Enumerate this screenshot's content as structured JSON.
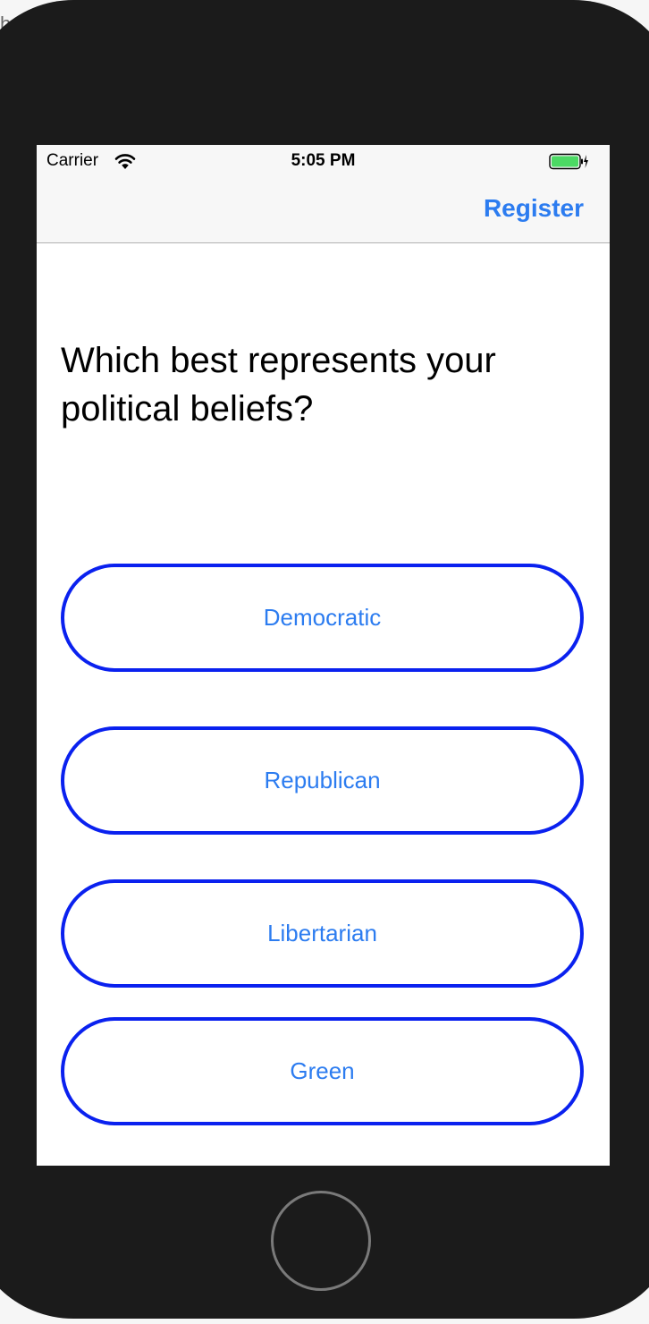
{
  "background": {
    "partial_text": "ho"
  },
  "status_bar": {
    "carrier": "Carrier",
    "time": "5:05 PM",
    "icons": [
      "wifi-icon",
      "battery-icon",
      "charging-bolt-icon"
    ]
  },
  "nav_bar": {
    "right_button_label": "Register"
  },
  "main": {
    "question": "Which best represents your political beliefs?",
    "options": [
      {
        "label": "Democratic"
      },
      {
        "label": "Republican"
      },
      {
        "label": "Libertarian"
      },
      {
        "label": "Green"
      }
    ]
  },
  "device": {
    "home_button": "home-button"
  },
  "colors": {
    "accent": "#2c7cf0",
    "option_border": "#0a21ef",
    "battery_fill": "#4cd964",
    "device_bezel": "#1b1b1b"
  }
}
